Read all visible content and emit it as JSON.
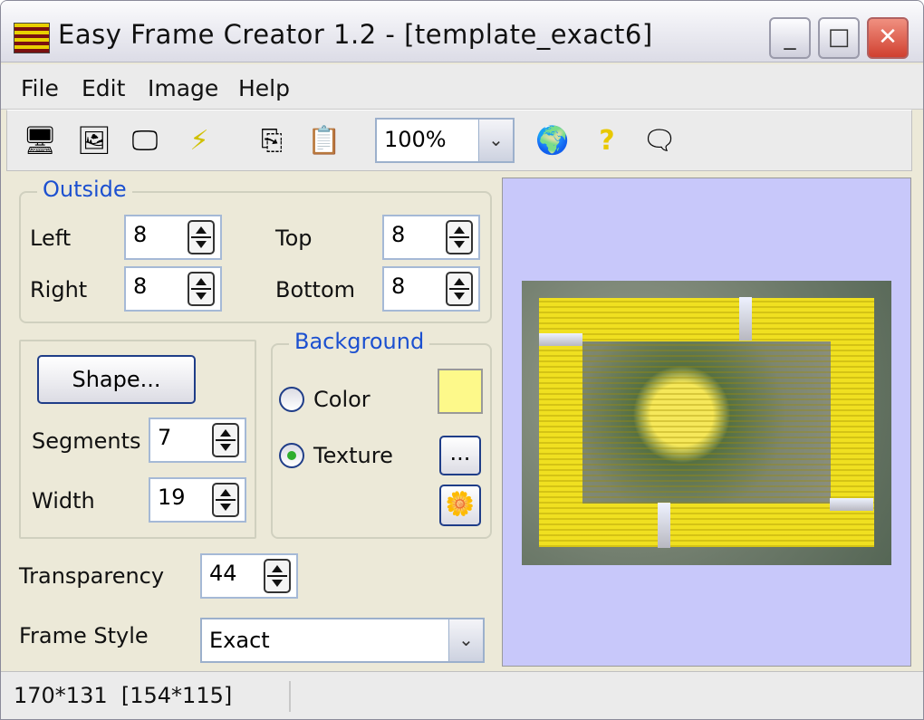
{
  "window": {
    "title": "Easy Frame Creator 1.2 - [template_exact6]"
  },
  "menu": [
    {
      "label": "File"
    },
    {
      "label": "Edit"
    },
    {
      "label": "Image"
    },
    {
      "label": "Help"
    }
  ],
  "toolbar": {
    "icons": [
      "open-icon",
      "image-icon",
      "export-icon",
      "lightning-icon",
      "copy-icon",
      "paste-icon",
      "globe-icon",
      "help-icon",
      "speech-bubble-icon"
    ],
    "zoom": "100%"
  },
  "outside": {
    "legend": "Outside",
    "left_label": "Left",
    "left": "8",
    "top_label": "Top",
    "top": "8",
    "right_label": "Right",
    "right": "8",
    "bottom_label": "Bottom",
    "bottom": "8"
  },
  "shape": {
    "button": "Shape...",
    "segments_label": "Segments",
    "segments": "7",
    "width_label": "Width",
    "width": "19"
  },
  "background": {
    "legend": "Background",
    "color_label": "Color",
    "texture_label": "Texture",
    "selected": "Texture",
    "swatch_color": "#fdf98a",
    "browse": "..."
  },
  "transparency": {
    "label": "Transparency",
    "value": "44"
  },
  "frame_style": {
    "label": "Frame Style",
    "value": "Exact"
  },
  "status": {
    "text": "170*131  [154*115]"
  }
}
